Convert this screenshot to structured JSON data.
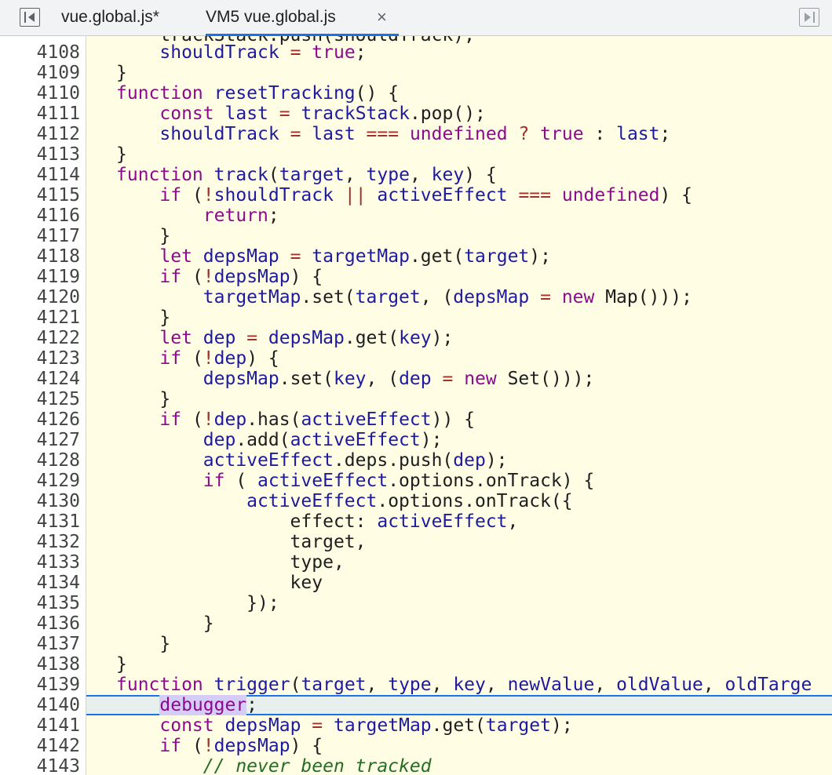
{
  "tabs": [
    {
      "label": "vue.global.js*"
    },
    {
      "label": "VM5 vue.global.js",
      "close": "×",
      "active": true
    }
  ],
  "icons": {
    "left": "toggle-navigator-icon",
    "right": "toggle-debugger-icon",
    "close": "close-icon"
  },
  "colors": {
    "keyword": "#8c0a8c",
    "identifier": "#1d1a9e",
    "comment": "#236e25",
    "code_bg": "#fffee5",
    "exec_line": "#e7f0ec",
    "accent": "#1a73e8"
  },
  "lines": [
    {
      "n": "4108",
      "segs": [
        {
          "t": "    "
        },
        {
          "t": "shouldTrack",
          "c": "id"
        },
        {
          "t": " "
        },
        {
          "t": "=",
          "c": "op"
        },
        {
          "t": " "
        },
        {
          "t": "true",
          "c": "lit"
        },
        {
          "t": ";"
        }
      ]
    },
    {
      "n": "4109",
      "segs": [
        {
          "t": "}"
        }
      ]
    },
    {
      "n": "4110",
      "segs": [
        {
          "t": "function",
          "c": "kw"
        },
        {
          "t": " "
        },
        {
          "t": "resetTracking",
          "c": "id"
        },
        {
          "t": "() {"
        }
      ]
    },
    {
      "n": "4111",
      "segs": [
        {
          "t": "    "
        },
        {
          "t": "const",
          "c": "kw"
        },
        {
          "t": " "
        },
        {
          "t": "last",
          "c": "id"
        },
        {
          "t": " "
        },
        {
          "t": "=",
          "c": "op"
        },
        {
          "t": " "
        },
        {
          "t": "trackStack",
          "c": "id"
        },
        {
          "t": ".pop();"
        }
      ]
    },
    {
      "n": "4112",
      "segs": [
        {
          "t": "    "
        },
        {
          "t": "shouldTrack",
          "c": "id"
        },
        {
          "t": " "
        },
        {
          "t": "=",
          "c": "op"
        },
        {
          "t": " "
        },
        {
          "t": "last",
          "c": "id"
        },
        {
          "t": " "
        },
        {
          "t": "===",
          "c": "op"
        },
        {
          "t": " "
        },
        {
          "t": "undefined",
          "c": "lit"
        },
        {
          "t": " "
        },
        {
          "t": "?",
          "c": "op"
        },
        {
          "t": " "
        },
        {
          "t": "true",
          "c": "lit"
        },
        {
          "t": " : "
        },
        {
          "t": "last",
          "c": "id"
        },
        {
          "t": ";"
        }
      ]
    },
    {
      "n": "4113",
      "segs": [
        {
          "t": "}"
        }
      ]
    },
    {
      "n": "4114",
      "segs": [
        {
          "t": "function",
          "c": "kw"
        },
        {
          "t": " "
        },
        {
          "t": "track",
          "c": "id"
        },
        {
          "t": "("
        },
        {
          "t": "target",
          "c": "id"
        },
        {
          "t": ", "
        },
        {
          "t": "type",
          "c": "id"
        },
        {
          "t": ", "
        },
        {
          "t": "key",
          "c": "id"
        },
        {
          "t": ") {"
        }
      ]
    },
    {
      "n": "4115",
      "segs": [
        {
          "t": "    "
        },
        {
          "t": "if",
          "c": "kw"
        },
        {
          "t": " ("
        },
        {
          "t": "!",
          "c": "op"
        },
        {
          "t": "shouldTrack",
          "c": "id"
        },
        {
          "t": " "
        },
        {
          "t": "||",
          "c": "op"
        },
        {
          "t": " "
        },
        {
          "t": "activeEffect",
          "c": "id"
        },
        {
          "t": " "
        },
        {
          "t": "===",
          "c": "op"
        },
        {
          "t": " "
        },
        {
          "t": "undefined",
          "c": "lit"
        },
        {
          "t": ") {"
        }
      ]
    },
    {
      "n": "4116",
      "segs": [
        {
          "t": "        "
        },
        {
          "t": "return",
          "c": "kw"
        },
        {
          "t": ";"
        }
      ]
    },
    {
      "n": "4117",
      "segs": [
        {
          "t": "    }"
        }
      ]
    },
    {
      "n": "4118",
      "segs": [
        {
          "t": "    "
        },
        {
          "t": "let",
          "c": "kw"
        },
        {
          "t": " "
        },
        {
          "t": "depsMap",
          "c": "id"
        },
        {
          "t": " "
        },
        {
          "t": "=",
          "c": "op"
        },
        {
          "t": " "
        },
        {
          "t": "targetMap",
          "c": "id"
        },
        {
          "t": ".get("
        },
        {
          "t": "target",
          "c": "id"
        },
        {
          "t": ");"
        }
      ]
    },
    {
      "n": "4119",
      "segs": [
        {
          "t": "    "
        },
        {
          "t": "if",
          "c": "kw"
        },
        {
          "t": " ("
        },
        {
          "t": "!",
          "c": "op"
        },
        {
          "t": "depsMap",
          "c": "id"
        },
        {
          "t": ") {"
        }
      ]
    },
    {
      "n": "4120",
      "segs": [
        {
          "t": "        "
        },
        {
          "t": "targetMap",
          "c": "id"
        },
        {
          "t": ".set("
        },
        {
          "t": "target",
          "c": "id"
        },
        {
          "t": ", ("
        },
        {
          "t": "depsMap",
          "c": "id"
        },
        {
          "t": " "
        },
        {
          "t": "=",
          "c": "op"
        },
        {
          "t": " "
        },
        {
          "t": "new",
          "c": "kw"
        },
        {
          "t": " Map()));"
        }
      ]
    },
    {
      "n": "4121",
      "segs": [
        {
          "t": "    }"
        }
      ]
    },
    {
      "n": "4122",
      "segs": [
        {
          "t": "    "
        },
        {
          "t": "let",
          "c": "kw"
        },
        {
          "t": " "
        },
        {
          "t": "dep",
          "c": "id"
        },
        {
          "t": " "
        },
        {
          "t": "=",
          "c": "op"
        },
        {
          "t": " "
        },
        {
          "t": "depsMap",
          "c": "id"
        },
        {
          "t": ".get("
        },
        {
          "t": "key",
          "c": "id"
        },
        {
          "t": ");"
        }
      ]
    },
    {
      "n": "4123",
      "segs": [
        {
          "t": "    "
        },
        {
          "t": "if",
          "c": "kw"
        },
        {
          "t": " ("
        },
        {
          "t": "!",
          "c": "op"
        },
        {
          "t": "dep",
          "c": "id"
        },
        {
          "t": ") {"
        }
      ]
    },
    {
      "n": "4124",
      "segs": [
        {
          "t": "        "
        },
        {
          "t": "depsMap",
          "c": "id"
        },
        {
          "t": ".set("
        },
        {
          "t": "key",
          "c": "id"
        },
        {
          "t": ", ("
        },
        {
          "t": "dep",
          "c": "id"
        },
        {
          "t": " "
        },
        {
          "t": "=",
          "c": "op"
        },
        {
          "t": " "
        },
        {
          "t": "new",
          "c": "kw"
        },
        {
          "t": " Set()));"
        }
      ]
    },
    {
      "n": "4125",
      "segs": [
        {
          "t": "    }"
        }
      ]
    },
    {
      "n": "4126",
      "segs": [
        {
          "t": "    "
        },
        {
          "t": "if",
          "c": "kw"
        },
        {
          "t": " ("
        },
        {
          "t": "!",
          "c": "op"
        },
        {
          "t": "dep",
          "c": "id"
        },
        {
          "t": ".has("
        },
        {
          "t": "activeEffect",
          "c": "id"
        },
        {
          "t": ")) {"
        }
      ]
    },
    {
      "n": "4127",
      "segs": [
        {
          "t": "        "
        },
        {
          "t": "dep",
          "c": "id"
        },
        {
          "t": ".add("
        },
        {
          "t": "activeEffect",
          "c": "id"
        },
        {
          "t": ");"
        }
      ]
    },
    {
      "n": "4128",
      "segs": [
        {
          "t": "        "
        },
        {
          "t": "activeEffect",
          "c": "id"
        },
        {
          "t": ".deps.push("
        },
        {
          "t": "dep",
          "c": "id"
        },
        {
          "t": ");"
        }
      ]
    },
    {
      "n": "4129",
      "segs": [
        {
          "t": "        "
        },
        {
          "t": "if",
          "c": "kw"
        },
        {
          "t": " ( "
        },
        {
          "t": "activeEffect",
          "c": "id"
        },
        {
          "t": ".options.onTrack) {"
        }
      ]
    },
    {
      "n": "4130",
      "segs": [
        {
          "t": "            "
        },
        {
          "t": "activeEffect",
          "c": "id"
        },
        {
          "t": ".options.onTrack({"
        }
      ]
    },
    {
      "n": "4131",
      "segs": [
        {
          "t": "                effect: "
        },
        {
          "t": "activeEffect",
          "c": "id"
        },
        {
          "t": ","
        }
      ]
    },
    {
      "n": "4132",
      "segs": [
        {
          "t": "                target,"
        }
      ]
    },
    {
      "n": "4133",
      "segs": [
        {
          "t": "                type,"
        }
      ]
    },
    {
      "n": "4134",
      "segs": [
        {
          "t": "                key"
        }
      ]
    },
    {
      "n": "4135",
      "segs": [
        {
          "t": "            });"
        }
      ]
    },
    {
      "n": "4136",
      "segs": [
        {
          "t": "        }"
        }
      ]
    },
    {
      "n": "4137",
      "segs": [
        {
          "t": "    }"
        }
      ]
    },
    {
      "n": "4138",
      "segs": [
        {
          "t": "}"
        }
      ]
    },
    {
      "n": "4139",
      "segs": [
        {
          "t": "function",
          "c": "kw"
        },
        {
          "t": " "
        },
        {
          "t": "trigger",
          "c": "id"
        },
        {
          "t": "("
        },
        {
          "t": "target",
          "c": "id"
        },
        {
          "t": ", "
        },
        {
          "t": "type",
          "c": "id"
        },
        {
          "t": ", "
        },
        {
          "t": "key",
          "c": "id"
        },
        {
          "t": ", "
        },
        {
          "t": "newValue",
          "c": "id"
        },
        {
          "t": ", "
        },
        {
          "t": "oldValue",
          "c": "id"
        },
        {
          "t": ", "
        },
        {
          "t": "oldTarge",
          "c": "id"
        }
      ]
    },
    {
      "n": "4140",
      "exec": true,
      "segs": [
        {
          "t": "    "
        },
        {
          "t": "debugger",
          "c": "kw hl"
        },
        {
          "t": ";"
        }
      ]
    },
    {
      "n": "4141",
      "segs": [
        {
          "t": "    "
        },
        {
          "t": "const",
          "c": "kw"
        },
        {
          "t": " "
        },
        {
          "t": "depsMap",
          "c": "id"
        },
        {
          "t": " "
        },
        {
          "t": "=",
          "c": "op"
        },
        {
          "t": " "
        },
        {
          "t": "targetMap",
          "c": "id"
        },
        {
          "t": ".get("
        },
        {
          "t": "target",
          "c": "id"
        },
        {
          "t": ");"
        }
      ]
    },
    {
      "n": "4142",
      "segs": [
        {
          "t": "    "
        },
        {
          "t": "if",
          "c": "kw"
        },
        {
          "t": " ("
        },
        {
          "t": "!",
          "c": "op"
        },
        {
          "t": "depsMap",
          "c": "id"
        },
        {
          "t": ") {"
        }
      ]
    },
    {
      "n": "4143",
      "segs": [
        {
          "t": "        "
        },
        {
          "t": "// never been tracked",
          "c": "cm"
        }
      ]
    }
  ]
}
